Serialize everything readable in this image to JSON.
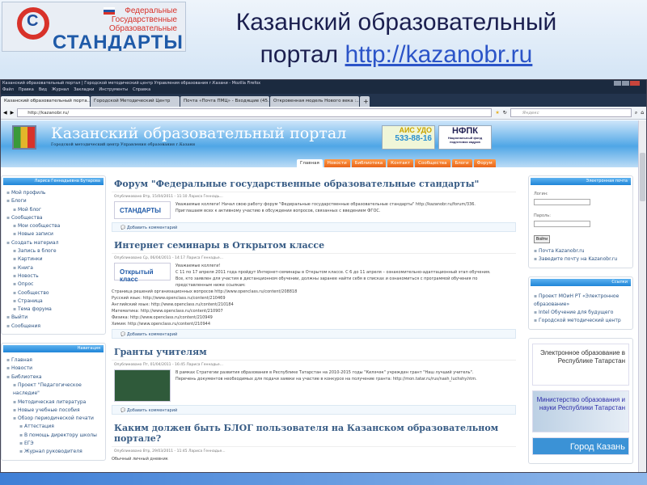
{
  "slide": {
    "logo": {
      "lines": [
        "Федеральные",
        "Государственные",
        "Образовательные"
      ],
      "big": "СТАНДАРТЫ"
    },
    "title_line1": "Казанский образовательный",
    "title_line2": "портал",
    "title_link": "http://kazanobr.ru"
  },
  "browser": {
    "window_title": "Казанский образовательный портал | Городской методический центр Управления образования г.Казани - Mozilla Firefox",
    "menu": [
      "Файл",
      "Правка",
      "Вид",
      "Журнал",
      "Закладки",
      "Инструменты",
      "Справка"
    ],
    "tabs": [
      "Казанский образовательный порта...",
      "Городской Методический Центр",
      "Почта «Почта ПМЦ» - Входящие (45...",
      "Откровенная модель Нового века :...",
      "+"
    ],
    "url": "http://kazanobr.ru/",
    "search_placeholder": "Яндекс"
  },
  "site": {
    "title": "Казанский образовательный портал",
    "subtitle": "Городской методический центр Управления образования г.Казани",
    "banner1": {
      "title": "АИС УДО",
      "phone": "533-88-16"
    },
    "banner2": {
      "title": "НФПК",
      "sub": "Национальный фонд подготовки кадров"
    },
    "nav": [
      "Главная",
      "Новости",
      "Библиотека",
      "Контакт",
      "Сообщества",
      "Блоги",
      "Форум"
    ]
  },
  "user_block": {
    "title": "Лариса Геннадьевна Бутарова",
    "items": [
      {
        "t": "Мой профиль",
        "l": 0
      },
      {
        "t": "Блоги",
        "l": 0
      },
      {
        "t": "Мой блог",
        "l": 1
      },
      {
        "t": "Сообщества",
        "l": 0
      },
      {
        "t": "Мои сообщества",
        "l": 1
      },
      {
        "t": "Новые записи",
        "l": 1
      },
      {
        "t": "Создать материал",
        "l": 0
      },
      {
        "t": "Запись в блоге",
        "l": 1
      },
      {
        "t": "Картинки",
        "l": 1
      },
      {
        "t": "Книга",
        "l": 1
      },
      {
        "t": "Новость",
        "l": 1
      },
      {
        "t": "Опрос",
        "l": 1
      },
      {
        "t": "Сообщество",
        "l": 1
      },
      {
        "t": "Страница",
        "l": 1
      },
      {
        "t": "Тема форума",
        "l": 1
      },
      {
        "t": "Выйти",
        "l": 0
      },
      {
        "t": "Сообщения",
        "l": 0
      }
    ]
  },
  "nav_block": {
    "title": "Навигация",
    "items": [
      {
        "t": "Главная",
        "l": 0
      },
      {
        "t": "Новости",
        "l": 0
      },
      {
        "t": "Библиотека",
        "l": 0
      },
      {
        "t": "Проект \"Педагогическое наследие\"",
        "l": 1
      },
      {
        "t": "Методическая литература",
        "l": 1
      },
      {
        "t": "Новые учебные пособия",
        "l": 1
      },
      {
        "t": "Обзор периодической печати",
        "l": 1
      },
      {
        "t": "Аттестация",
        "l": 2
      },
      {
        "t": "В помощь директору школы",
        "l": 2
      },
      {
        "t": "ЕГЭ",
        "l": 2
      },
      {
        "t": "Журнал руководителя",
        "l": 2
      }
    ]
  },
  "posts": [
    {
      "title": "Форум \"Федеральные государственные образовательные стандарты\"",
      "meta": "Опубликовано Втр, 15/04/2011 - 11:10 Лариса Геннадь...",
      "thumb": "СТАНДАРТЫ",
      "lines": [
        "Уважаемые коллеги! Начал свою работу форум \"Федеральные государственные образовательные стандарты\" http://kazanobr.ru/forum/336.",
        "Приглашаем всех к активному участию в обсуждении вопросов, связанных с введением ФГОС."
      ],
      "comment": "Добавить комментарий"
    },
    {
      "title": "Интернет семинары в Открытом классе",
      "meta": "Опубликовано Ср, 06/04/2011 - 14:17 Лариса Геннадье...",
      "thumb": "Открытый класс",
      "lines": [
        "Уважаемые коллеги!",
        "С 11 по 17 апреля 2011 года пройдут Интернет-семинары в Открытом классе. С 6 до 11 апреля – ознакомительно-адаптационный этап обучения.",
        "Все, кто заявлен для участия в дистанционном обучении, должны заранее найти себя в списках и ознакомиться с программой обучения по",
        "представленным ниже ссылкам:",
        "Страница решений организационных вопросов http://www.openclass.ru/content/208818",
        "Русский язык: http://www.openclass.ru/content/210469",
        "Английский язык: http://www.openclass.ru/content/210184",
        "Математика: http://www.openclass.ru/content/210907",
        "Физика: http://www.openclass.ru/content/210949",
        "Химия: http://www.openclass.ru/content/210944"
      ],
      "comment": "Добавить комментарий"
    },
    {
      "title": "Гранты учителям",
      "meta": "Опубликовано Пт, 01/04/2011 - 16:45 Лариса Геннадье...",
      "lines": [
        "В рамках Стратегии развития образования в Республике Татарстан на 2010-2015 годы \"Киләчәк\" учрежден грант \"Наш лучший учитель\".",
        "Перечень документов необходимых для подачи заявки на участие в конкурсе на получение гранта: http://mon.tatar.ru/rus/nash_luchshy.htm."
      ],
      "comment": "Добавить комментарий"
    },
    {
      "title": "Каким должен быть БЛОГ пользователя на Казанском образовательном портале?",
      "meta": "Опубликовано Втр, 29/03/2011 - 11:45 Лариса Геннадье...",
      "lines": [
        "Обычный личный дневник"
      ]
    }
  ],
  "login_block": {
    "title": "Электронная почта",
    "login_label": "Логин:",
    "password_label": "Пароль:",
    "submit": "Войти",
    "links": [
      "Почта Kazanobr.ru",
      "Заведите почту на Kazanobr.ru"
    ]
  },
  "links_block": {
    "title": "Ссылки",
    "items": [
      "Проект МОиН РТ «Электронное образование»",
      "Intel Обучение для будущего",
      "Городской методический центр"
    ]
  },
  "banners": [
    "Электронное образование в Республике Татарстан",
    "Министерство образования и науки Республики Татарстан",
    "Город Казань"
  ]
}
